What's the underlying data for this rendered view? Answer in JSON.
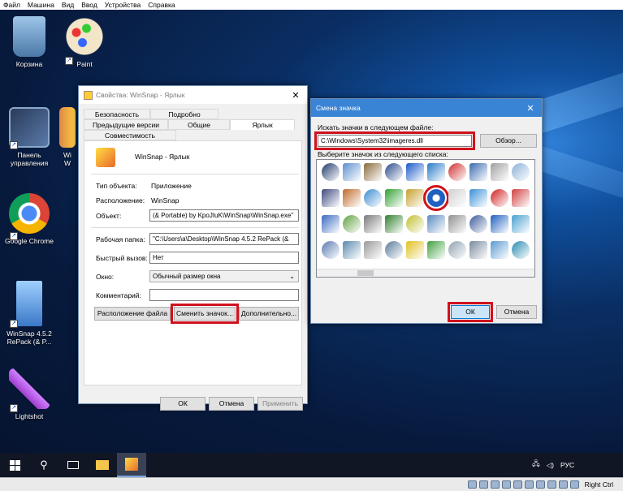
{
  "menu": [
    "Файл",
    "Машина",
    "Вид",
    "Ввод",
    "Устройства",
    "Справка"
  ],
  "desktop_icons": [
    {
      "label": "Корзина"
    },
    {
      "label": "Paint"
    },
    {
      "label": "Панель управления"
    },
    {
      "label": "Wi\nW"
    },
    {
      "label": "Google Chrome"
    },
    {
      "label": "WinSnap 4.5.2 RePack (& P..."
    },
    {
      "label": "Lightshot"
    }
  ],
  "props": {
    "title": "Свойства: WinSnap - Ярлык",
    "tabs_row1": [
      "Безопасность",
      "Подробно",
      "Предыдущие версии"
    ],
    "tabs_row2": [
      "Общие",
      "Ярлык",
      "Совместимость"
    ],
    "name": "WinSnap - Ярлык",
    "type_label": "Тип объекта:",
    "type_value": "Приложение",
    "location_label": "Расположение:",
    "location_value": "WinSnap",
    "object_label": "Объект:",
    "object_value": "(& Portable) by KpoJIuK\\WinSnap\\WinSnap.exe\"",
    "workdir_label": "Рабочая папка:",
    "workdir_value": "\"C:\\Users\\a\\Desktop\\WinSnap 4.5.2 RePack (&",
    "hotkey_label": "Быстрый вызов:",
    "hotkey_value": "Нет",
    "window_label": "Окно:",
    "window_value": "Обычный размер окна",
    "comment_label": "Комментарий:",
    "comment_value": "",
    "btn_location": "Расположение файла",
    "btn_change_icon": "Сменить значок...",
    "btn_advanced": "Дополнительно...",
    "ok": "ОК",
    "cancel": "Отмена",
    "apply": "Применить"
  },
  "changeicon": {
    "title": "Смена значка",
    "search_label": "Искать значки в следующем файле:",
    "path": "C:\\Windows\\System32\\imageres.dll",
    "browse": "Обзор...",
    "select_label": "Выберите значок из следующего списка:",
    "ok": "ОК",
    "cancel": "Отмена",
    "icon_colors": [
      "#1f3a6a",
      "#5b8fd0",
      "#8a6a3a",
      "#2a4a8a",
      "#1a5ac8",
      "#2a7ac8",
      "#d03030",
      "#3a6ab0",
      "#a0a0a0",
      "#8ab0d8",
      "#404a80",
      "#c06a2a",
      "#3a8ad0",
      "#30a030",
      "#c8a030",
      "#2060c0",
      "#d0d0d0",
      "#3a90d8",
      "#d02020",
      "#d04040",
      "#3a6ac0",
      "#60a040",
      "#7a7a7a",
      "#308030",
      "#c0c030",
      "#5a8ac0",
      "#909090",
      "#3a5a9a",
      "#2060c0",
      "#4aa0d0",
      "#5a7ab0",
      "#5a8ab0",
      "#9a9a9a",
      "#5a7a9a",
      "#e0c020",
      "#40a040",
      "#90a0b0",
      "#7a8aa0",
      "#5a9ad0",
      "#2a8ab0"
    ]
  },
  "taskbar": {
    "lang": "РУС"
  },
  "statusbar": {
    "hostkey": "Right Ctrl"
  }
}
